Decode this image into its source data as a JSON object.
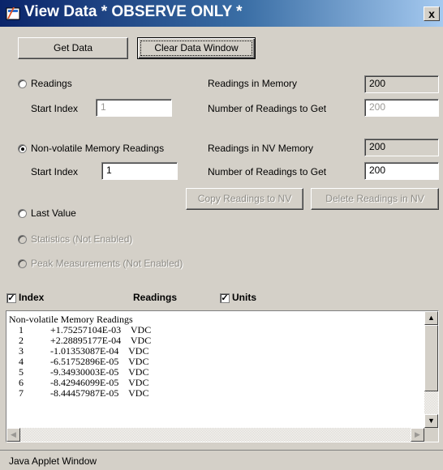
{
  "window": {
    "title": "View Data * OBSERVE ONLY *",
    "close_label": "x"
  },
  "toolbar": {
    "get_data_label": "Get Data",
    "clear_label": "Clear Data Window"
  },
  "readings": {
    "label": "Readings",
    "start_index_label": "Start Index",
    "start_index_value": "1",
    "in_memory_label": "Readings in Memory",
    "in_memory_value": "200",
    "to_get_label": "Number of Readings to Get",
    "to_get_value": "200"
  },
  "nv": {
    "label": "Non-volatile Memory Readings",
    "start_index_label": "Start Index",
    "start_index_value": "1",
    "in_memory_label": "Readings in NV Memory",
    "in_memory_value": "200",
    "to_get_label": "Number of Readings to Get",
    "to_get_value": "200",
    "copy_label": "Copy Readings to NV",
    "delete_label": "Delete Readings in NV"
  },
  "last_value_label": "Last Value",
  "statistics_label": "Statistics (Not Enabled)",
  "peak_label": "Peak Measurements (Not Enabled)",
  "columns": {
    "index_label": "Index",
    "readings_label": "Readings",
    "units_label": "Units",
    "index_checked": "✓",
    "units_checked": "✓"
  },
  "output": {
    "header": "Non-volatile Memory Readings",
    "rows": [
      {
        "index": "1",
        "value": "+1.75257104E-03",
        "unit": "VDC"
      },
      {
        "index": "2",
        "value": "+2.28895177E-04",
        "unit": "VDC"
      },
      {
        "index": "3",
        "value": "-1.01353087E-04",
        "unit": "VDC"
      },
      {
        "index": "4",
        "value": "-6.51752896E-05",
        "unit": "VDC"
      },
      {
        "index": "5",
        "value": "-9.34930003E-05",
        "unit": "VDC"
      },
      {
        "index": "6",
        "value": "-8.42946099E-05",
        "unit": "VDC"
      },
      {
        "index": "7",
        "value": "-8.44457987E-05",
        "unit": "VDC"
      }
    ]
  },
  "status": "Java Applet Window"
}
